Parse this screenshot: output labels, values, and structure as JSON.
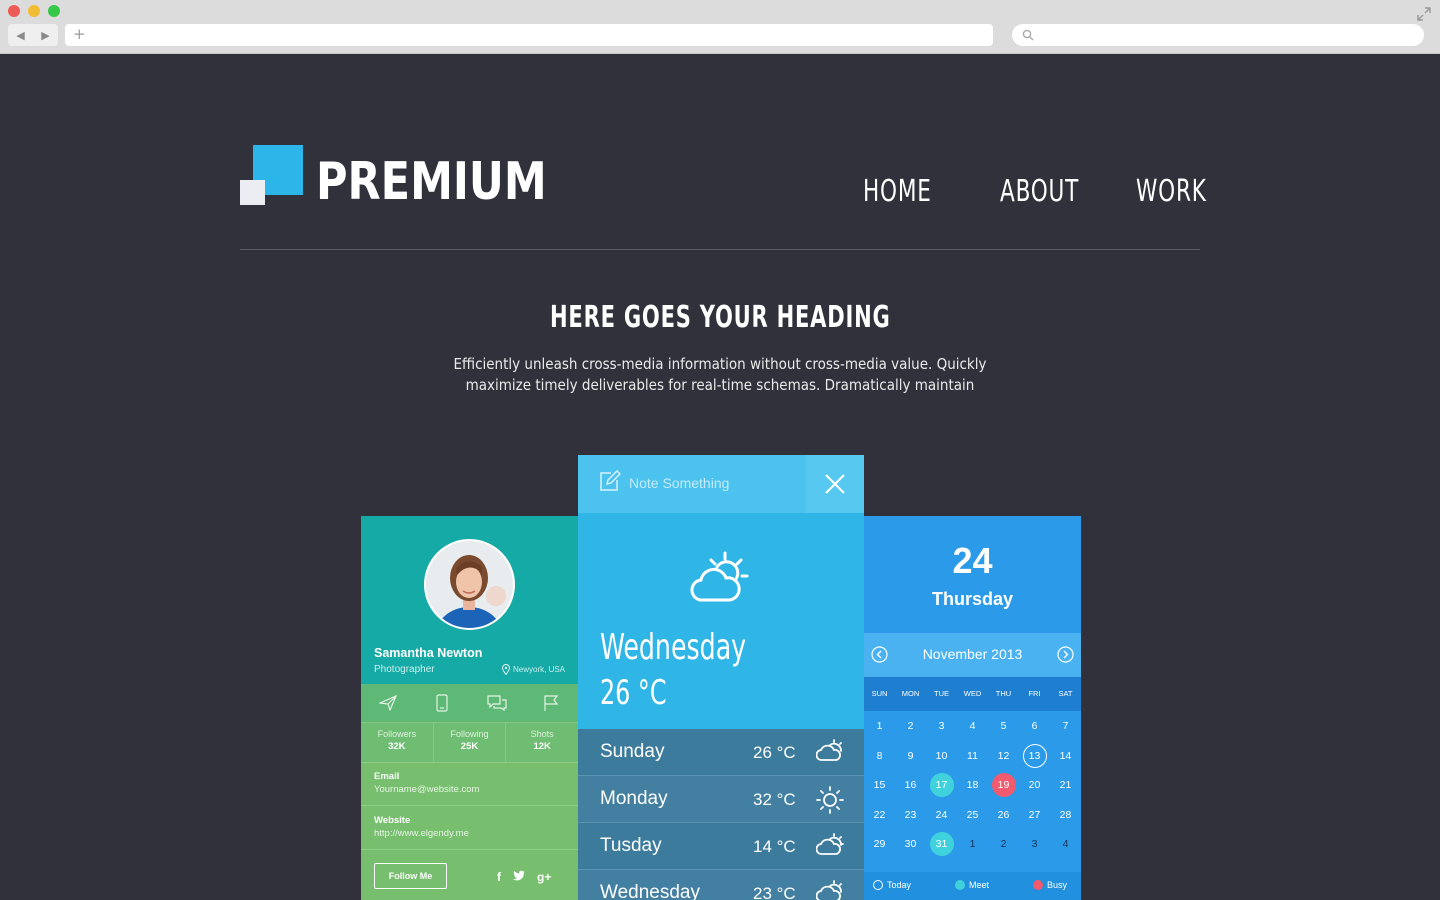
{
  "brand": {
    "name": "PREMIUM",
    "accent": "#2cb5e8"
  },
  "nav": [
    {
      "label": "HOME"
    },
    {
      "label": "ABOUT"
    },
    {
      "label": "WORK"
    }
  ],
  "hero": {
    "heading": "HERE GOES YOUR HEADING",
    "line1": "Efficiently unleash cross-media information without cross-media value. Quickly",
    "line2": "maximize timely deliverables for real-time schemas. Dramatically maintain"
  },
  "profile": {
    "name": "Samantha Newton",
    "role": "Photographer",
    "location": "Newyork, USA",
    "icons": [
      "send-icon",
      "phone-icon",
      "chat-icon",
      "flag-icon"
    ],
    "stats": [
      {
        "label": "Followers",
        "value": "32K"
      },
      {
        "label": "Following",
        "value": "25K"
      },
      {
        "label": "Shots",
        "value": "12K"
      }
    ],
    "email_label": "Email",
    "email": "Yourname@website.com",
    "website_label": "Website",
    "website": "http://www.elgendy.me",
    "follow_label": "Follow Me",
    "social": {
      "facebook": "f",
      "google": "g+"
    }
  },
  "weather": {
    "note_placeholder": "Note Something",
    "day": "Wednesday",
    "temp": "26 °C",
    "forecast": [
      {
        "day": "Sunday",
        "temp": "26 °C",
        "icon": "cloud-icon"
      },
      {
        "day": "Monday",
        "temp": "32 °C",
        "icon": "sun-icon"
      },
      {
        "day": "Tusday",
        "temp": "14 °C",
        "icon": "partly-cloudy-icon"
      },
      {
        "day": "Wednesday",
        "temp": "23 °C",
        "icon": "partly-cloudy-icon"
      }
    ]
  },
  "calendar": {
    "date": "24",
    "dayname": "Thursday",
    "month": "November 2013",
    "weekdays": [
      "SUN",
      "MON",
      "TUE",
      "WED",
      "THU",
      "FRI",
      "SAT"
    ],
    "weeks": [
      [
        "1",
        "2",
        "3",
        "4",
        "5",
        "6",
        "7"
      ],
      [
        "8",
        "9",
        "10",
        "11",
        "12",
        "13",
        "14"
      ],
      [
        "15",
        "16",
        "17",
        "18",
        "19",
        "20",
        "21"
      ],
      [
        "22",
        "23",
        "24",
        "25",
        "26",
        "27",
        "28"
      ],
      [
        "29",
        "30",
        "31",
        "1",
        "2",
        "3",
        "4"
      ]
    ],
    "marks": {
      "today": "13",
      "meet": [
        "17",
        "31"
      ],
      "busy": "19"
    },
    "legend": {
      "today": "Today",
      "meet": "Meet",
      "busy": "Busy"
    },
    "colors": {
      "meet": "#40d2dc",
      "busy": "#f25a6e"
    }
  }
}
